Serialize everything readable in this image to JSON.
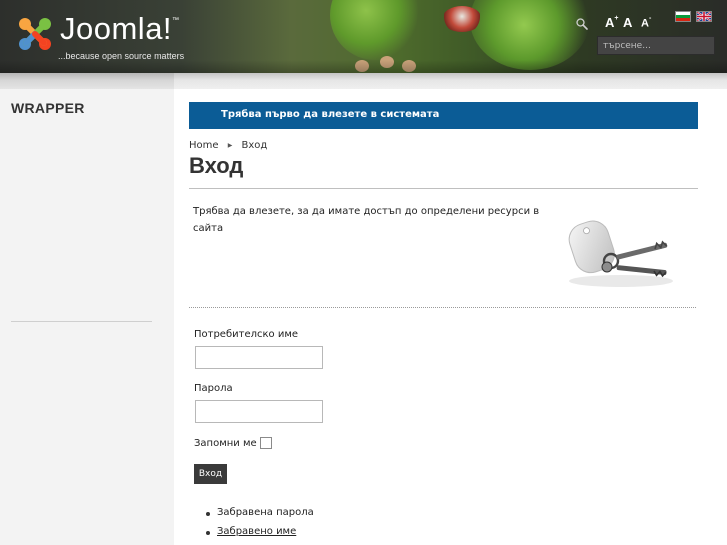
{
  "header": {
    "logo": {
      "wordmark": "Joomla!",
      "trademark": "™",
      "tagline": "...because open source matters"
    },
    "tools": {
      "search_icon": "search-icon",
      "font_increase": "A",
      "font_increase_sup": "+",
      "font_reset": "A",
      "font_decrease": "A",
      "font_decrease_sup": "-"
    },
    "languages": [
      "bg",
      "en"
    ],
    "search": {
      "placeholder": "търсене..."
    }
  },
  "sidebar": {
    "title": "WRAPPER"
  },
  "main": {
    "notice": "Трябва първо да влезете в системата",
    "breadcrumb": {
      "home": "Home",
      "current": "Вход"
    },
    "title": "Вход",
    "description": "Трябва да влезете, за да имате достъп до определени ресурси в сайта",
    "image": "keys-image",
    "form": {
      "username_label": "Потребителско име",
      "username_value": "",
      "password_label": "Парола",
      "password_value": "",
      "remember_label": "Запомни ме",
      "remember_checked": false,
      "submit_label": "Вход"
    },
    "links": [
      {
        "label": "Забравена парола"
      },
      {
        "label": "Забравено име"
      }
    ]
  },
  "colors": {
    "notice_bg": "#0b5c96",
    "button_bg": "#3a3a3a",
    "sidebar_bg": "#f3f3f3"
  }
}
